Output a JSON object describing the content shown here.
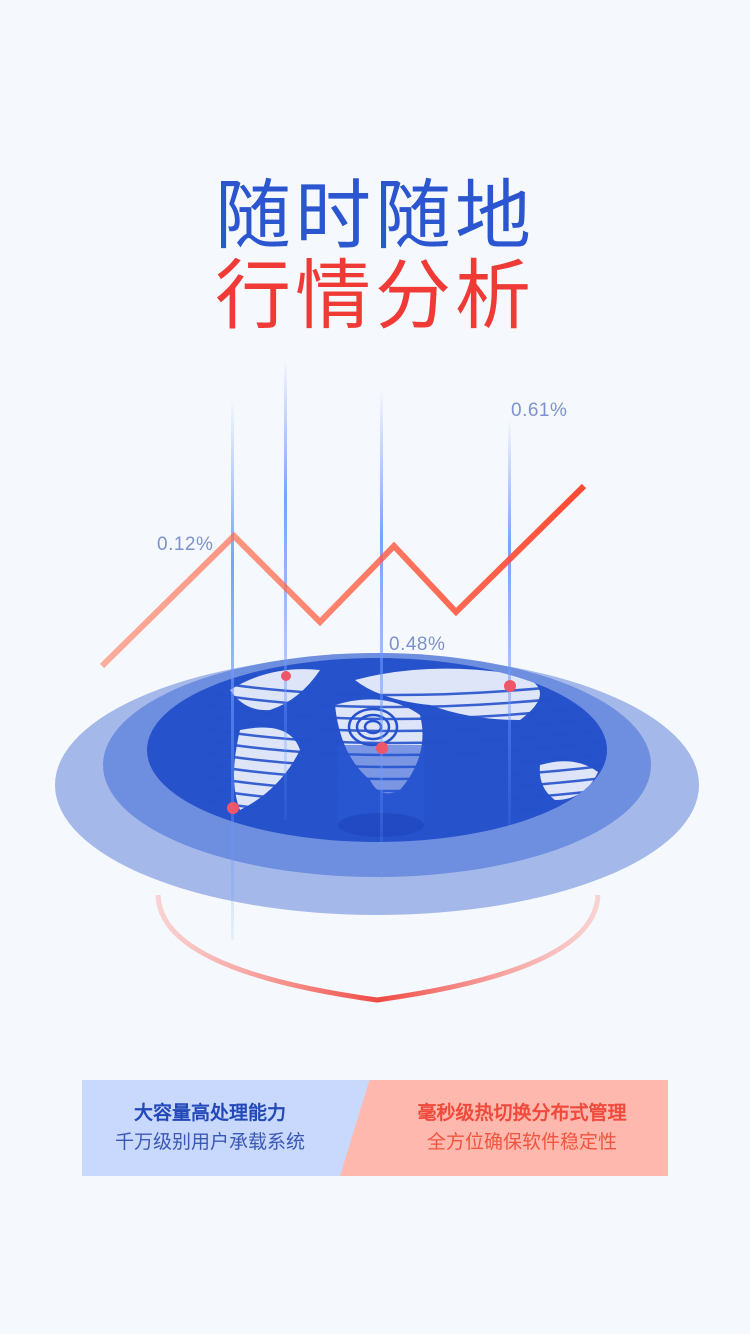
{
  "header": {
    "title_line1": "随时随地",
    "title_line2": "行情分析"
  },
  "chart_labels": {
    "left": "0.12%",
    "center": "0.48%",
    "right": "0.61%"
  },
  "features": {
    "left": {
      "title": "大容量高处理能力",
      "subtitle": "千万级别用户承载系统"
    },
    "right": {
      "title": "毫秒级热切换分布式管理",
      "subtitle": "全方位确保软件稳定性"
    }
  },
  "colors": {
    "blue_accent": "#2b56cf",
    "red_accent": "#ef3a36",
    "background": "#f5f8fc"
  }
}
